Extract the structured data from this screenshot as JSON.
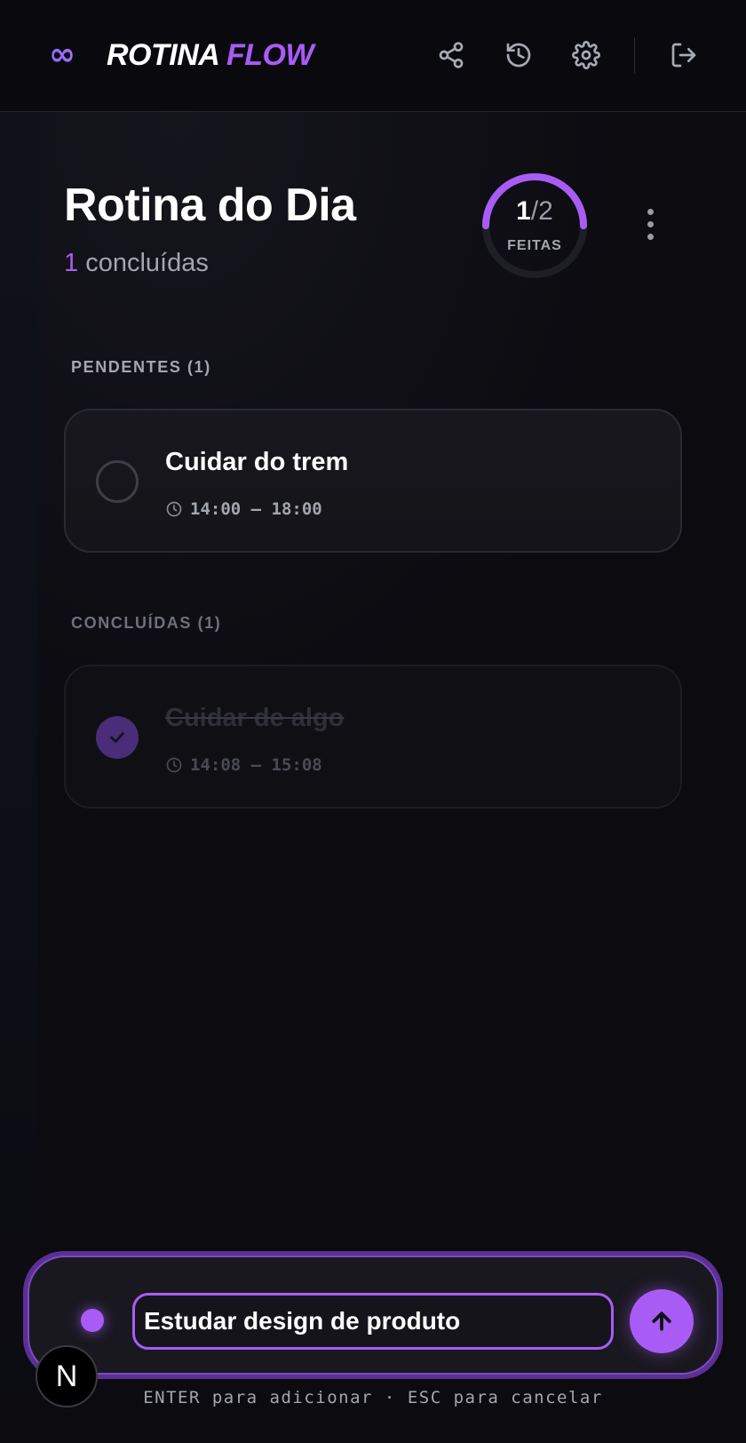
{
  "header": {
    "logo_icon": "infinity-icon",
    "logo_glyph": "∞",
    "brand_part1": "ROTINA",
    "brand_part2": "FLOW",
    "actions": [
      "share-icon",
      "history-icon",
      "settings-icon",
      "logout-icon"
    ]
  },
  "page": {
    "title": "Rotina do Dia",
    "completed_count": "1",
    "completed_suffix": "concluídas"
  },
  "progress": {
    "done": "1",
    "separator": "/",
    "total": "2",
    "label": "FEITAS",
    "fraction": 0.5,
    "color": "#a95cf5"
  },
  "sections": {
    "pending_label": "PENDENTES (1)",
    "pending_color": "#a4a6ae",
    "done_label": "CONCLUÍDAS (1)",
    "done_color": "#6e707a"
  },
  "pending_tasks": [
    {
      "title": "Cuidar do trem",
      "time": "14:00 – 18:00"
    }
  ],
  "done_tasks": [
    {
      "title": "Cuidar de algo",
      "time": "14:08 – 15:08"
    }
  ],
  "composer": {
    "input_value": "Estudar design de produto",
    "send_icon": "arrow-up-icon",
    "hint": "ENTER para adicionar · ESC para cancelar"
  },
  "badge": {
    "letter": "N"
  },
  "colors": {
    "accent": "#a95cf5",
    "background": "#0b0b10"
  }
}
